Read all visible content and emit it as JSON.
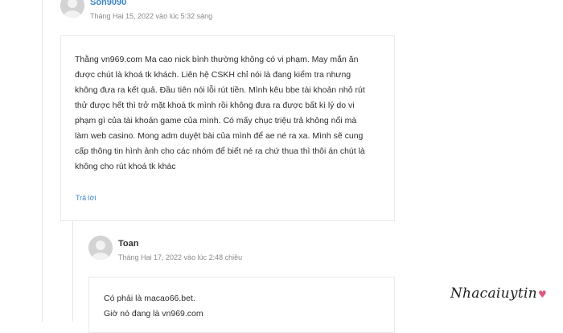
{
  "comment1": {
    "author": "Son9090",
    "date": "Tháng Hai 15, 2022 vào lúc 5:32 sáng",
    "lines": [
      "Thằng vn969.com Ma cao nick bình thường không có vi phạm. May mắn ăn",
      "được chút là khoá tk khách. Liên hệ CSKH chỉ nói là đang kiểm tra nhưng",
      "không đưa ra kết quả. Đầu tiên nói lỗi rút tiền. Mình kêu bbe tài khoản nhỏ rút",
      "thử được hết thì trở mặt khoá tk mình rồi không đưa ra được bất kì lý do vi",
      "phạm gì của tài khoản game của mình. Có mấy chục triệu trả không nổi mà",
      "làm web casino. Mong adm duyệt bài của mình để ae né ra xa. Mình sẽ cung",
      "cấp thông tin hình ảnh cho các nhóm để biết né ra chứ thua thì thôi án chút là",
      "không cho rút khoá tk khác"
    ],
    "reply_label": "Trả lời"
  },
  "comment2": {
    "author": "Toan",
    "date": "Tháng Hai 17, 2022 vào lúc 2:48 chiều",
    "lines": [
      "Có phải là macao66.bet.",
      "Giờ nó đang là vn969.com"
    ]
  },
  "watermark": {
    "text": "Nhacaiuytin",
    "heart": "♥",
    "heart_color": "#e05a7f"
  },
  "icons": [
    "avatar-icon"
  ]
}
